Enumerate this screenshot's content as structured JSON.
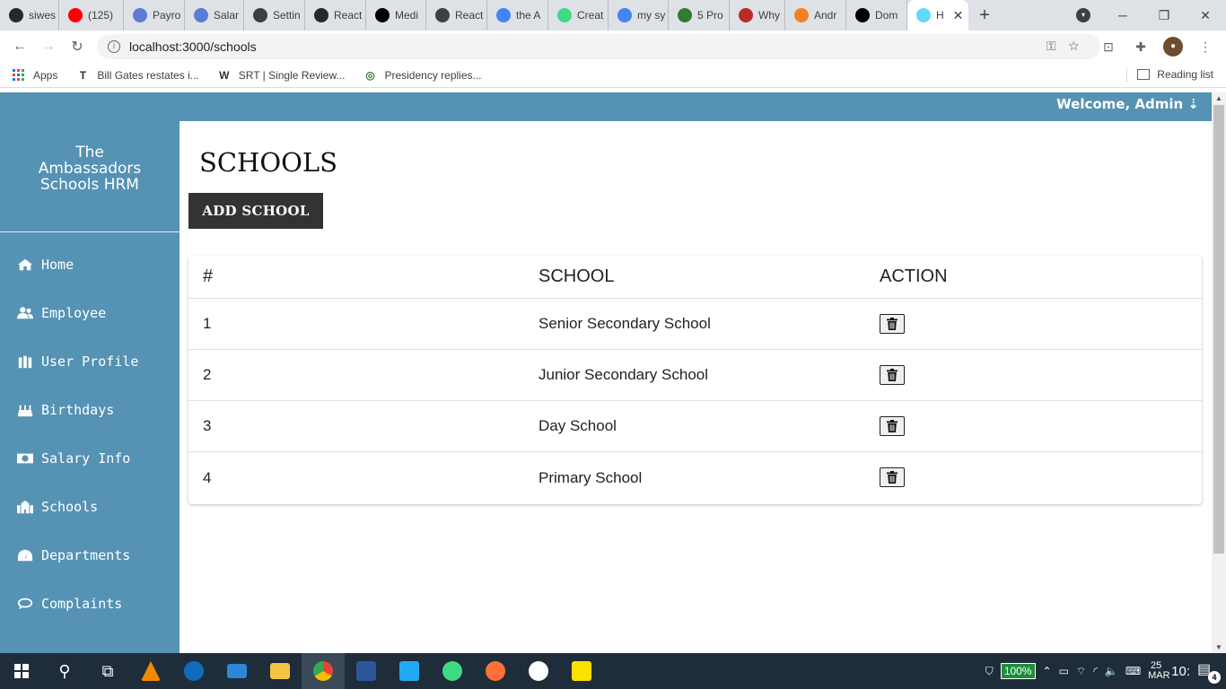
{
  "browser": {
    "tabs": [
      {
        "label": "siwes",
        "icon": "github-icon",
        "color": "#24292e"
      },
      {
        "label": "(125)",
        "icon": "youtube-icon",
        "color": "#ff0000"
      },
      {
        "label": "Payro",
        "icon": "globe-icon",
        "color": "#5b7bd5"
      },
      {
        "label": "Salar",
        "icon": "globe-icon",
        "color": "#5b7bd5"
      },
      {
        "label": "Settin",
        "icon": "settings-globe-icon",
        "color": "#3c4043"
      },
      {
        "label": "React",
        "icon": "github-icon",
        "color": "#24292e"
      },
      {
        "label": "Medi",
        "icon": "medium-icon",
        "color": "#000000"
      },
      {
        "label": "React",
        "icon": "react-diamond-icon",
        "color": "#3c4043"
      },
      {
        "label": "the A",
        "icon": "google-icon",
        "color": "#4285f4"
      },
      {
        "label": "Creat",
        "icon": "android-icon",
        "color": "#3ddc84"
      },
      {
        "label": "my sy",
        "icon": "google-icon",
        "color": "#4285f4"
      },
      {
        "label": "5 Pro",
        "icon": "bit-icon",
        "color": "#2e7d32"
      },
      {
        "label": "Why",
        "icon": "quora-icon",
        "color": "#b92b27"
      },
      {
        "label": "Andr",
        "icon": "stackoverflow-icon",
        "color": "#f48024"
      },
      {
        "label": "Dom",
        "icon": "feed-icon",
        "color": "#000000"
      },
      {
        "label": "H",
        "icon": "react-icon",
        "color": "#61dafb"
      }
    ],
    "active_tab_index": 15,
    "url": "localhost:3000/schools",
    "bookmarks": [
      {
        "label": "Apps",
        "icon": "apps-grid-icon"
      },
      {
        "label": "Bill Gates restates i...",
        "icon": "tribune-icon"
      },
      {
        "label": "SRT | Single Review...",
        "icon": "wordpress-icon"
      },
      {
        "label": "Presidency replies...",
        "icon": "news-icon"
      }
    ],
    "reading_list": "Reading list"
  },
  "app": {
    "welcome": "Welcome, Admin ⇣",
    "brand": [
      "The",
      "Ambassadors",
      "Schools HRM"
    ],
    "nav": [
      {
        "label": "Home",
        "icon": "home-icon"
      },
      {
        "label": "Employee",
        "icon": "users-icon"
      },
      {
        "label": "User Profile",
        "icon": "id-badge-icon"
      },
      {
        "label": "Birthdays",
        "icon": "birthday-cake-icon"
      },
      {
        "label": "Salary Info",
        "icon": "money-bill-icon"
      },
      {
        "label": "Schools",
        "icon": "school-icon"
      },
      {
        "label": "Departments",
        "icon": "tachometer-icon"
      },
      {
        "label": "Complaints",
        "icon": "comment-icon"
      }
    ],
    "page_title": "SCHOOLS",
    "add_button": "ADD SCHOOL",
    "table": {
      "headers": [
        "#",
        "SCHOOL",
        "ACTION"
      ],
      "rows": [
        {
          "id": "1",
          "name": "Senior Secondary School"
        },
        {
          "id": "2",
          "name": "Junior Secondary School"
        },
        {
          "id": "3",
          "name": "Day School"
        },
        {
          "id": "4",
          "name": "Primary School"
        }
      ]
    },
    "colors": {
      "sidebar": "#5592b4",
      "button": "#333333"
    }
  },
  "taskbar": {
    "battery": "100%",
    "date": "25 MAR",
    "time": "10:",
    "notifications": "4"
  }
}
